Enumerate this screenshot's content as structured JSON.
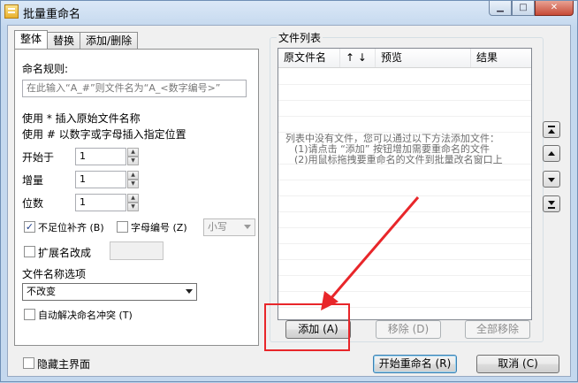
{
  "window": {
    "title": "批量重命名"
  },
  "tabs": [
    "整体",
    "替换",
    "添加/删除"
  ],
  "overall": {
    "naming_rule_label": "命名规则:",
    "naming_rule_placeholder": "在此输入“A_#”则文件名为“A_<数字编号>”",
    "help1": "使用 * 插入原始文件名称",
    "help2": "使用 # 以数字或字母插入指定位置",
    "start_label": "开始于",
    "start_value": "1",
    "step_label": "增量",
    "step_value": "1",
    "digits_label": "位数",
    "digits_value": "1",
    "pad_label": "不足位补齐 (B)",
    "pad_checked": true,
    "letter_label": "字母编号 (Z)",
    "letter_checked": false,
    "case_value": "小写",
    "ext_label": "扩展名改成",
    "ext_checked": false,
    "ext_value": "",
    "filename_options_label": "文件名称选项",
    "filename_option_value": "不改变",
    "auto_resolve_label": "自动解决命名冲突 (T)",
    "auto_resolve_checked": false
  },
  "filelist": {
    "group_label": "文件列表",
    "columns": [
      "原文件名",
      "↑ ↓",
      "预览",
      "结果"
    ],
    "empty_lines": [
      "列表中没有文件，您可以通过以下方法添加文件：",
      "(1)请点击 “添加” 按钮增加需要重命名的文件",
      "(2)用鼠标拖拽要重命名的文件到批量改名窗口上"
    ],
    "add_button": "添加 (A)",
    "remove_button": "移除 (D)",
    "remove_all_button": "全部移除"
  },
  "bottom": {
    "hide_main_label": "隐藏主界面",
    "hide_main_checked": false,
    "start_rename_button": "开始重命名 (R)",
    "cancel_button": "取消 (C)"
  }
}
